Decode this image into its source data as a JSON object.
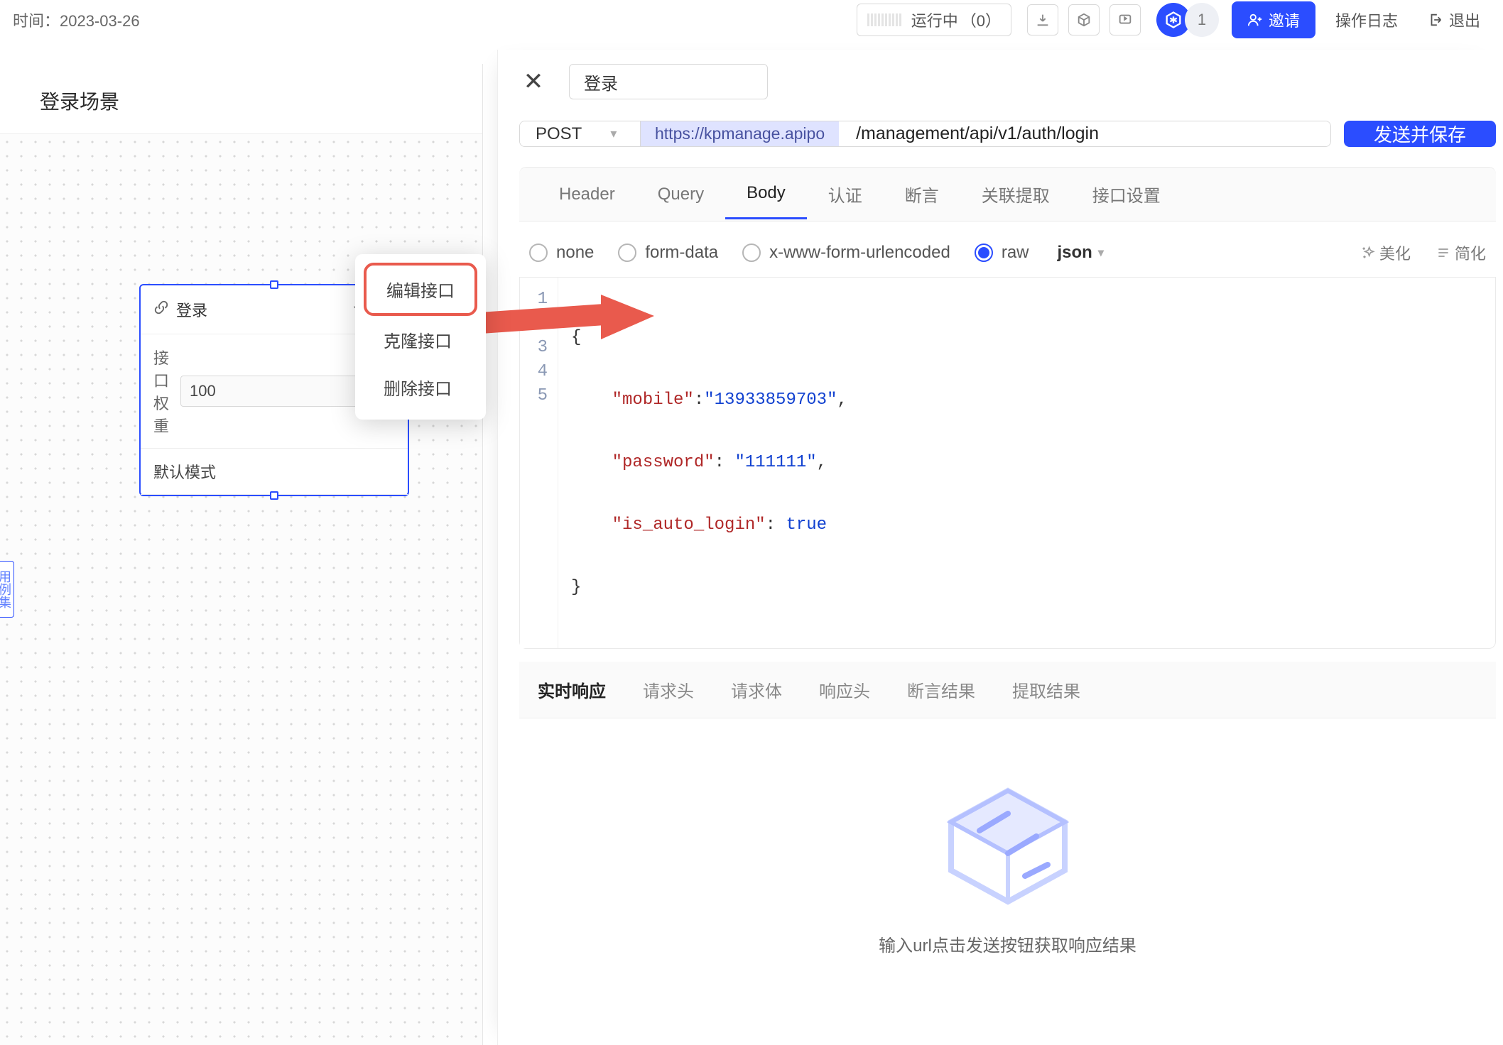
{
  "topbar": {
    "time_label": "时间：",
    "time_value": "2023-03-26",
    "running_label": "运行中",
    "running_count": "（0）",
    "user_count": "1",
    "invite_label": "邀请",
    "log_label": "操作日志",
    "exit_label": "退出"
  },
  "canvas": {
    "title": "登录场景",
    "card": {
      "title": "登录",
      "weight_label": "接口权重",
      "weight_value": "100",
      "mode_label": "默认模式"
    },
    "side_vertical_tab": "用例集",
    "context_menu": {
      "edit": "编辑接口",
      "clone": "克隆接口",
      "delete": "删除接口"
    }
  },
  "panel": {
    "title_input": "登录",
    "method": "POST",
    "base_url": "https://kpmanage.apipo",
    "path": "/management/api/v1/auth/login",
    "send_label": "发送并保存",
    "tabs": {
      "header": "Header",
      "query": "Query",
      "body": "Body",
      "auth": "认证",
      "assert": "断言",
      "extract": "关联提取",
      "settings": "接口设置"
    },
    "body_types": {
      "none": "none",
      "form": "form-data",
      "urlenc": "x-www-form-urlencoded",
      "raw": "raw",
      "raw_format": "json"
    },
    "tool_beautify": "美化",
    "tool_simplify": "简化",
    "code": {
      "1": "{",
      "2_key": "\"mobile\"",
      "2_val": "\"13933859703\"",
      "3_key": "\"password\"",
      "3_val": "\"111111\"",
      "4_key": "\"is_auto_login\"",
      "4_val": "true",
      "5": "}"
    },
    "response_tabs": {
      "realtime": "实时响应",
      "req_head": "请求头",
      "req_body": "请求体",
      "res_head": "响应头",
      "assert_res": "断言结果",
      "extract_res": "提取结果"
    },
    "empty_hint": "输入url点击发送按钮获取响应结果"
  }
}
